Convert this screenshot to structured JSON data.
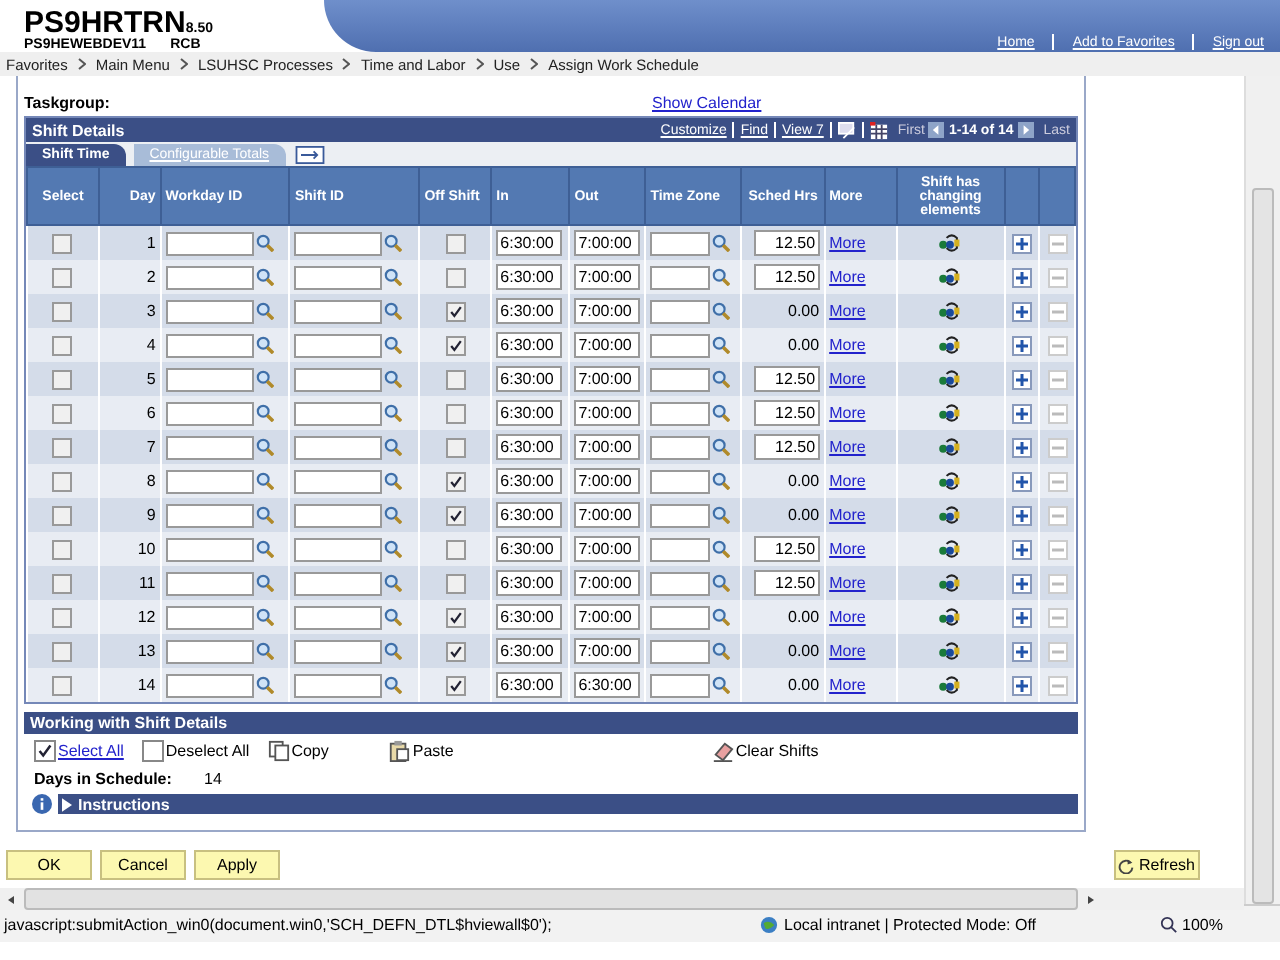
{
  "header": {
    "app": "PS9HRTRN",
    "version": "8.50",
    "server": "PS9HEWEBDEV11",
    "user": "RCB",
    "links": [
      "Home",
      "Add to Favorites",
      "Sign out"
    ]
  },
  "breadcrumbs": [
    "Favorites",
    "Main Menu",
    "LSUHSC Processes",
    "Time and Labor",
    "Use",
    "Assign Work Schedule"
  ],
  "taskgroup": {
    "label": "Taskgroup:",
    "link": "Show Calendar"
  },
  "shift_details": {
    "title": "Shift Details",
    "tools": [
      "Customize",
      "Find",
      "View 7"
    ],
    "first": "First",
    "range": "1-14 of 14",
    "last": "Last",
    "tabs": [
      {
        "label": "Shift Time",
        "selected": true
      },
      {
        "label": "Configurable Totals",
        "selected": false
      }
    ],
    "columns": [
      "Select",
      "Day",
      "Workday ID",
      "Shift ID",
      "Off Shift",
      "In",
      "Out",
      "Time Zone",
      "Sched Hrs",
      "More",
      "Shift has changing elements"
    ],
    "rows": [
      {
        "selected": false,
        "day": "1",
        "off_shift": false,
        "in": "6:30:00",
        "out": "7:00:00",
        "sched_hrs_editable": true,
        "sched_hrs": "12.50",
        "more": "More"
      },
      {
        "selected": false,
        "day": "2",
        "off_shift": false,
        "in": "6:30:00",
        "out": "7:00:00",
        "sched_hrs_editable": true,
        "sched_hrs": "12.50",
        "more": "More"
      },
      {
        "selected": false,
        "day": "3",
        "off_shift": true,
        "in": "6:30:00",
        "out": "7:00:00",
        "sched_hrs_editable": false,
        "sched_hrs": "0.00",
        "more": "More"
      },
      {
        "selected": false,
        "day": "4",
        "off_shift": true,
        "in": "6:30:00",
        "out": "7:00:00",
        "sched_hrs_editable": false,
        "sched_hrs": "0.00",
        "more": "More"
      },
      {
        "selected": false,
        "day": "5",
        "off_shift": false,
        "in": "6:30:00",
        "out": "7:00:00",
        "sched_hrs_editable": true,
        "sched_hrs": "12.50",
        "more": "More"
      },
      {
        "selected": false,
        "day": "6",
        "off_shift": false,
        "in": "6:30:00",
        "out": "7:00:00",
        "sched_hrs_editable": true,
        "sched_hrs": "12.50",
        "more": "More"
      },
      {
        "selected": false,
        "day": "7",
        "off_shift": false,
        "in": "6:30:00",
        "out": "7:00:00",
        "sched_hrs_editable": true,
        "sched_hrs": "12.50",
        "more": "More"
      },
      {
        "selected": false,
        "day": "8",
        "off_shift": true,
        "in": "6:30:00",
        "out": "7:00:00",
        "sched_hrs_editable": false,
        "sched_hrs": "0.00",
        "more": "More"
      },
      {
        "selected": false,
        "day": "9",
        "off_shift": true,
        "in": "6:30:00",
        "out": "7:00:00",
        "sched_hrs_editable": false,
        "sched_hrs": "0.00",
        "more": "More"
      },
      {
        "selected": false,
        "day": "10",
        "off_shift": false,
        "in": "6:30:00",
        "out": "7:00:00",
        "sched_hrs_editable": true,
        "sched_hrs": "12.50",
        "more": "More"
      },
      {
        "selected": false,
        "day": "11",
        "off_shift": false,
        "in": "6:30:00",
        "out": "7:00:00",
        "sched_hrs_editable": true,
        "sched_hrs": "12.50",
        "more": "More"
      },
      {
        "selected": false,
        "day": "12",
        "off_shift": true,
        "in": "6:30:00",
        "out": "7:00:00",
        "sched_hrs_editable": false,
        "sched_hrs": "0.00",
        "more": "More"
      },
      {
        "selected": false,
        "day": "13",
        "off_shift": true,
        "in": "6:30:00",
        "out": "7:00:00",
        "sched_hrs_editable": false,
        "sched_hrs": "0.00",
        "more": "More"
      },
      {
        "selected": false,
        "day": "14",
        "off_shift": true,
        "in": "6:30:00",
        "out": "6:30:00",
        "sched_hrs_editable": false,
        "sched_hrs": "0.00",
        "more": "More"
      }
    ]
  },
  "working": {
    "title": "Working with Shift Details",
    "select_all": {
      "label": "Select All",
      "checked": true
    },
    "deselect_all": {
      "label": "Deselect All",
      "checked": false
    },
    "copy": "Copy",
    "paste": "Paste",
    "clear": "Clear Shifts",
    "days_label": "Days in Schedule:",
    "days_value": "14",
    "instructions": "Instructions"
  },
  "buttons": [
    "OK",
    "Cancel",
    "Apply"
  ],
  "refresh": "Refresh",
  "status_bar": {
    "url": "javascript:submitAction_win0(document.win0,'SCH_DEFN_DTL$hviewall$0');",
    "zone": "Local intranet | Protected Mode: Off",
    "zoom": "100%"
  }
}
